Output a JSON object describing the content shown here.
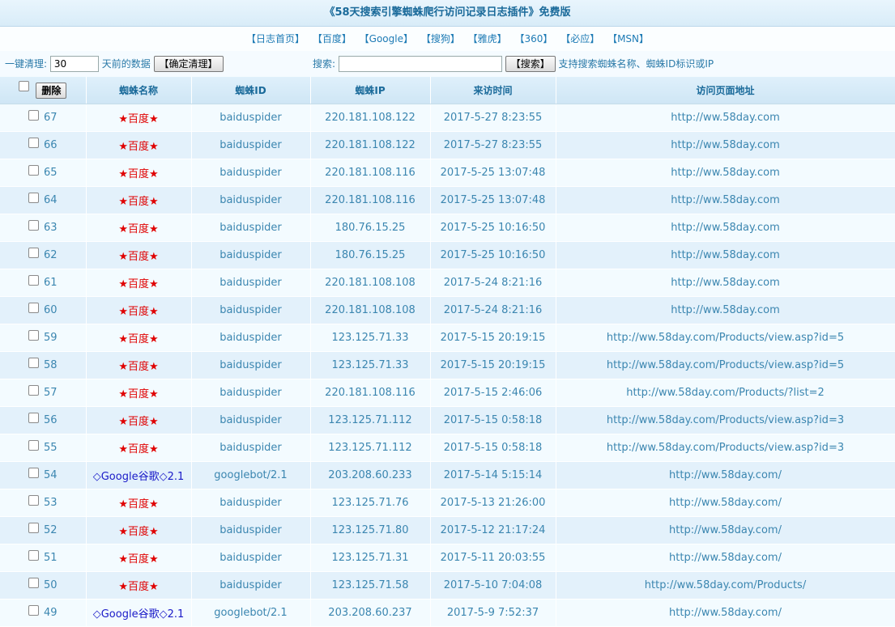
{
  "header": {
    "title": "《58天搜索引擎蜘蛛爬行访问记录日志插件》免费版"
  },
  "nav": [
    {
      "label": "【日志首页】"
    },
    {
      "label": "【百度】"
    },
    {
      "label": "【Google】"
    },
    {
      "label": "【搜狗】"
    },
    {
      "label": "【雅虎】"
    },
    {
      "label": "【360】"
    },
    {
      "label": "【必应】"
    },
    {
      "label": "【MSN】"
    }
  ],
  "toolbar": {
    "clean_label": "一键清理:",
    "days_value": "30",
    "days_suffix": "天前的数据",
    "confirm_clean": "【确定清理】",
    "search_label": "搜索:",
    "search_value": "",
    "search_button": "【搜索】",
    "search_hint": "支持搜索蜘蛛名称、蜘蛛ID标识或IP"
  },
  "table": {
    "delete_button": "删除",
    "columns": [
      "蜘蛛名称",
      "蜘蛛ID",
      "蜘蛛IP",
      "来访时间",
      "访问页面地址"
    ],
    "rows": [
      {
        "id": "67",
        "name": "★百度★",
        "spider": "baiduspider",
        "ip": "220.181.108.122",
        "time": "2017-5-27 8:23:55",
        "url": "http://ww.58day.com",
        "type": "baidu"
      },
      {
        "id": "66",
        "name": "★百度★",
        "spider": "baiduspider",
        "ip": "220.181.108.122",
        "time": "2017-5-27 8:23:55",
        "url": "http://ww.58day.com",
        "type": "baidu"
      },
      {
        "id": "65",
        "name": "★百度★",
        "spider": "baiduspider",
        "ip": "220.181.108.116",
        "time": "2017-5-25 13:07:48",
        "url": "http://ww.58day.com",
        "type": "baidu"
      },
      {
        "id": "64",
        "name": "★百度★",
        "spider": "baiduspider",
        "ip": "220.181.108.116",
        "time": "2017-5-25 13:07:48",
        "url": "http://ww.58day.com",
        "type": "baidu"
      },
      {
        "id": "63",
        "name": "★百度★",
        "spider": "baiduspider",
        "ip": "180.76.15.25",
        "time": "2017-5-25 10:16:50",
        "url": "http://ww.58day.com",
        "type": "baidu"
      },
      {
        "id": "62",
        "name": "★百度★",
        "spider": "baiduspider",
        "ip": "180.76.15.25",
        "time": "2017-5-25 10:16:50",
        "url": "http://ww.58day.com",
        "type": "baidu"
      },
      {
        "id": "61",
        "name": "★百度★",
        "spider": "baiduspider",
        "ip": "220.181.108.108",
        "time": "2017-5-24 8:21:16",
        "url": "http://ww.58day.com",
        "type": "baidu"
      },
      {
        "id": "60",
        "name": "★百度★",
        "spider": "baiduspider",
        "ip": "220.181.108.108",
        "time": "2017-5-24 8:21:16",
        "url": "http://ww.58day.com",
        "type": "baidu"
      },
      {
        "id": "59",
        "name": "★百度★",
        "spider": "baiduspider",
        "ip": "123.125.71.33",
        "time": "2017-5-15 20:19:15",
        "url": "http://ww.58day.com/Products/view.asp?id=5",
        "type": "baidu"
      },
      {
        "id": "58",
        "name": "★百度★",
        "spider": "baiduspider",
        "ip": "123.125.71.33",
        "time": "2017-5-15 20:19:15",
        "url": "http://ww.58day.com/Products/view.asp?id=5",
        "type": "baidu"
      },
      {
        "id": "57",
        "name": "★百度★",
        "spider": "baiduspider",
        "ip": "220.181.108.116",
        "time": "2017-5-15 2:46:06",
        "url": "http://ww.58day.com/Products/?list=2",
        "type": "baidu"
      },
      {
        "id": "56",
        "name": "★百度★",
        "spider": "baiduspider",
        "ip": "123.125.71.112",
        "time": "2017-5-15 0:58:18",
        "url": "http://ww.58day.com/Products/view.asp?id=3",
        "type": "baidu"
      },
      {
        "id": "55",
        "name": "★百度★",
        "spider": "baiduspider",
        "ip": "123.125.71.112",
        "time": "2017-5-15 0:58:18",
        "url": "http://ww.58day.com/Products/view.asp?id=3",
        "type": "baidu"
      },
      {
        "id": "54",
        "name": "◇Google谷歌◇2.1",
        "spider": "googlebot/2.1",
        "ip": "203.208.60.233",
        "time": "2017-5-14 5:15:14",
        "url": "http://ww.58day.com/",
        "type": "google"
      },
      {
        "id": "53",
        "name": "★百度★",
        "spider": "baiduspider",
        "ip": "123.125.71.76",
        "time": "2017-5-13 21:26:00",
        "url": "http://ww.58day.com/",
        "type": "baidu"
      },
      {
        "id": "52",
        "name": "★百度★",
        "spider": "baiduspider",
        "ip": "123.125.71.80",
        "time": "2017-5-12 21:17:24",
        "url": "http://ww.58day.com/",
        "type": "baidu"
      },
      {
        "id": "51",
        "name": "★百度★",
        "spider": "baiduspider",
        "ip": "123.125.71.31",
        "time": "2017-5-11 20:03:55",
        "url": "http://ww.58day.com/",
        "type": "baidu"
      },
      {
        "id": "50",
        "name": "★百度★",
        "spider": "baiduspider",
        "ip": "123.125.71.58",
        "time": "2017-5-10 7:04:08",
        "url": "http://ww.58day.com/Products/",
        "type": "baidu"
      },
      {
        "id": "49",
        "name": "◇Google谷歌◇2.1",
        "spider": "googlebot/2.1",
        "ip": "203.208.60.237",
        "time": "2017-5-9 7:52:37",
        "url": "http://ww.58day.com/",
        "type": "google"
      }
    ]
  }
}
